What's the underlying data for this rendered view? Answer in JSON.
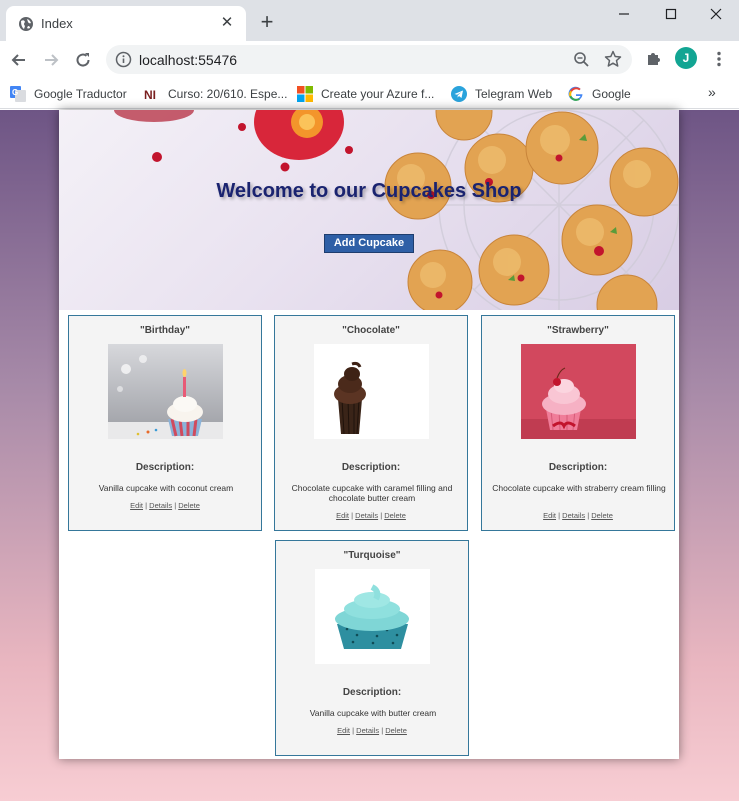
{
  "browser": {
    "tab_title": "Index",
    "url": "localhost:55476",
    "profile_initial": "J",
    "bookmarks": [
      {
        "label": "Google Traductor",
        "icon": "google-translate-icon"
      },
      {
        "label": "Curso: 20/610. Espe...",
        "icon": "ni-icon"
      },
      {
        "label": "Create your Azure f...",
        "icon": "microsoft-icon"
      },
      {
        "label": "Telegram Web",
        "icon": "telegram-icon"
      },
      {
        "label": "Google",
        "icon": "google-icon"
      }
    ],
    "more_bookmarks": "»"
  },
  "hero": {
    "title": "Welcome to our Cupcakes Shop",
    "add_button": "Add Cupcake"
  },
  "cupcakes": [
    {
      "name": "\"Birthday\"",
      "description_label": "Description:",
      "description": "Vanilla cupcake with coconut cream",
      "image": "birthday-cupcake"
    },
    {
      "name": "\"Chocolate\"",
      "description_label": "Description:",
      "description": "Chocolate cupcake with caramel filling and chocolate butter cream",
      "image": "chocolate-cupcake"
    },
    {
      "name": "\"Strawberry\"",
      "description_label": "Description:",
      "description": "Chocolate cupcake with straberry cream filling",
      "image": "strawberry-cupcake"
    },
    {
      "name": "\"Turquoise\"",
      "description_label": "Description:",
      "description": "Vanilla cupcake with butter cream",
      "image": "turquoise-cupcake"
    }
  ],
  "links": {
    "edit": "Edit",
    "details": "Details",
    "delete": "Delete",
    "separator": "|"
  }
}
